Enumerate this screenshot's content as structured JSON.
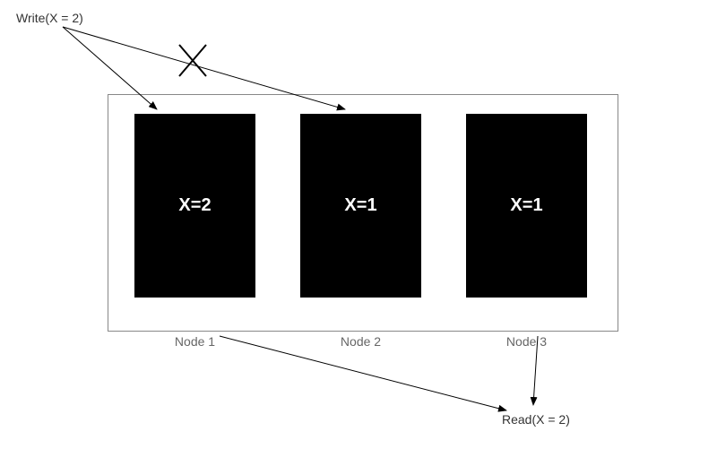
{
  "write": {
    "label": "Write(X = 2)"
  },
  "read": {
    "label": "Read(X = 2)"
  },
  "nodes": [
    {
      "label": "Node 1",
      "value": "X=2"
    },
    {
      "label": "Node 2",
      "value": "X=1"
    },
    {
      "label": "Node 3",
      "value": "X=1"
    }
  ],
  "diagram_meta": {
    "write_to_node1": "arrow delivered",
    "write_to_node2": "arrow crossed-out (write fails/does not reach)",
    "node1_to_read": "arrow",
    "node3_to_read": "arrow"
  }
}
